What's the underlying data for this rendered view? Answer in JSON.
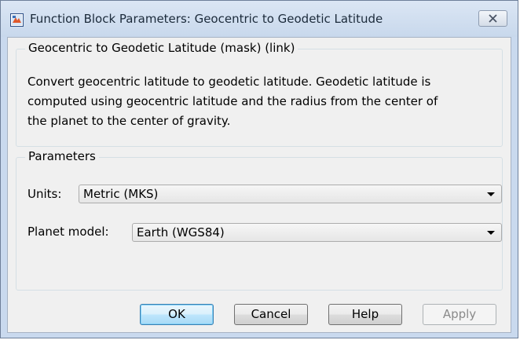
{
  "window": {
    "title": "Function Block Parameters: Geocentric to Geodetic Latitude",
    "icon": "simulink-block-icon",
    "close_icon": "close-icon"
  },
  "description_group": {
    "title": "Geocentric to Geodetic Latitude (mask) (link)",
    "lines": [
      "Convert geocentric latitude to geodetic latitude.  Geodetic latitude is",
      "computed using geocentric latitude and the radius from the center of",
      "the planet to the center of gravity."
    ]
  },
  "parameters_group": {
    "title": "Parameters",
    "units": {
      "label": "Units:",
      "value": "Metric (MKS)"
    },
    "planet_model": {
      "label": "Planet model:",
      "value": "Earth (WGS84)"
    }
  },
  "buttons": {
    "ok": "OK",
    "cancel": "Cancel",
    "help": "Help",
    "apply": "Apply"
  }
}
